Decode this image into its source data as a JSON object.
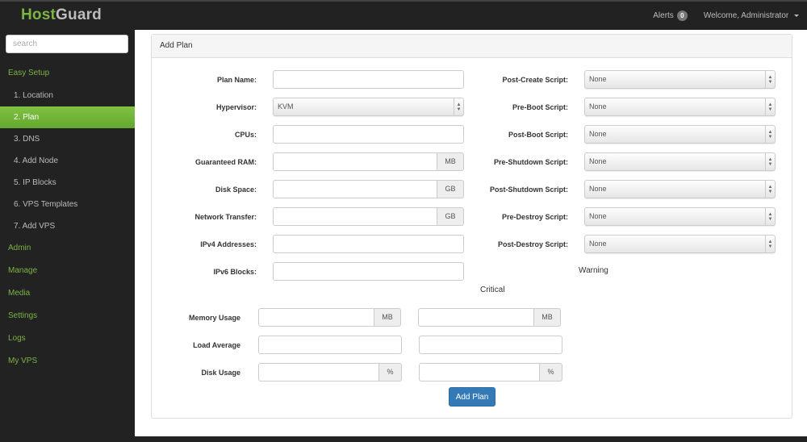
{
  "app": {
    "brand_part1": "Host",
    "brand_part2": "Guard"
  },
  "topnav": {
    "alerts_label": "Alerts",
    "alerts_count": "0",
    "welcome_label": "Welcome, Administrator"
  },
  "sidebar": {
    "search_placeholder": "search",
    "easy_setup": "Easy Setup",
    "steps": [
      "1. Location",
      "2. Plan",
      "3. DNS",
      "4. Add Node",
      "5. IP Blocks",
      "6. VPS Templates",
      "7. Add VPS"
    ],
    "active_step": "2. Plan",
    "sections": [
      "Admin",
      "Manage",
      "Media",
      "Settings",
      "Logs",
      "My VPS"
    ]
  },
  "colors": {
    "brand_green": "#7cb342",
    "primary_blue": "#337ab7",
    "sidebar_bg": "#222222"
  },
  "panel": {
    "title": "Add Plan",
    "left_fields": [
      {
        "label": "Plan Name:",
        "type": "text",
        "value": ""
      },
      {
        "label": "Hypervisor:",
        "type": "select",
        "value": "KVM"
      },
      {
        "label": "CPUs:",
        "type": "text",
        "value": ""
      },
      {
        "label": "Guaranteed RAM:",
        "type": "addon",
        "value": "",
        "unit": "MB"
      },
      {
        "label": "Disk Space:",
        "type": "addon",
        "value": "",
        "unit": "GB"
      },
      {
        "label": "Network Transfer:",
        "type": "addon",
        "value": "",
        "unit": "GB"
      },
      {
        "label": "IPv4 Addresses:",
        "type": "text",
        "value": ""
      },
      {
        "label": "IPv6 Blocks:",
        "type": "text",
        "value": ""
      }
    ],
    "right_fields": [
      {
        "label": "Post-Create Script:",
        "value": "None"
      },
      {
        "label": "Pre-Boot Script:",
        "value": "None"
      },
      {
        "label": "Post-Boot Script:",
        "value": "None"
      },
      {
        "label": "Pre-Shutdown Script:",
        "value": "None"
      },
      {
        "label": "Post-Shutdown Script:",
        "value": "None"
      },
      {
        "label": "Pre-Destroy Script:",
        "value": "None"
      },
      {
        "label": "Post-Destroy Script:",
        "value": "None"
      }
    ],
    "warning_label": "Warning",
    "critical_label": "Critical",
    "thresholds": [
      {
        "label": "Memory Usage",
        "unit": "MB",
        "warning": "",
        "critical": ""
      },
      {
        "label": "Load Average",
        "unit": "",
        "warning": "",
        "critical": ""
      },
      {
        "label": "Disk Usage",
        "unit": "%",
        "warning": "",
        "critical": ""
      }
    ],
    "submit_label": "Add Plan"
  }
}
